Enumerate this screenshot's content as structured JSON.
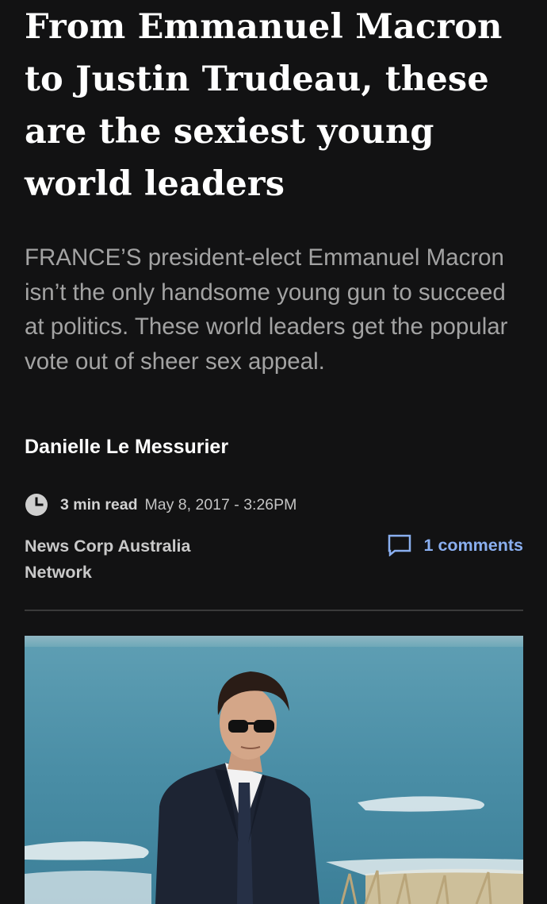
{
  "article": {
    "headline": "From Emmanuel Macron to Justin Trudeau, these are the sexiest young world leaders",
    "standfirst": "FRANCE’S president-elect Emmanuel Macron isn’t the only handsome young gun to succeed at politics. These world leaders get the popular vote out of sheer sex appeal.",
    "author": "Danielle Le Messurier",
    "read_time": "3 min read",
    "published": "May 8, 2017 - 3:26PM",
    "source": "News Corp Australia Network",
    "comments_label": "1 comments"
  },
  "icons": {
    "clock": "clock-icon",
    "comment": "comment-icon"
  },
  "colors": {
    "background": "#121213",
    "link": "#8aaff0",
    "muted": "#a3a3a3"
  }
}
